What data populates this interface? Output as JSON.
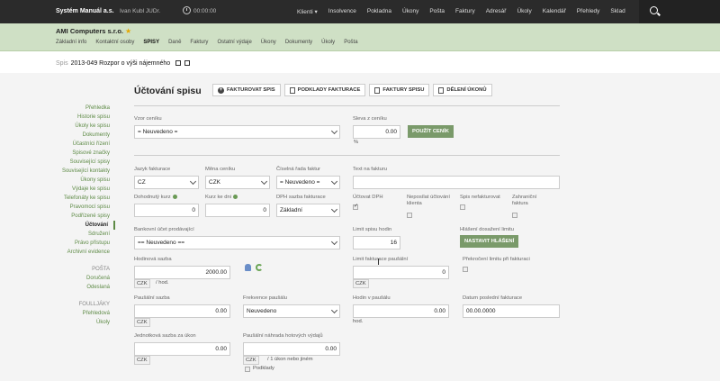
{
  "topbar": {
    "brand": "Systém Manuál a.s.",
    "user": "Ivan Kubl JUDr.",
    "timer": "00:00:00",
    "nav": [
      "Klienti ▾",
      "Insolvence",
      "Pokladna",
      "Úkony",
      "Pošta",
      "Faktury",
      "Adresář",
      "Úkoly",
      "Kalendář",
      "Přehledy",
      "Sklad"
    ]
  },
  "company": {
    "name": "AMI Computers s.r.o.",
    "tabs": [
      "Základní info",
      "Kontaktní osoby",
      "SPISY",
      "Daně",
      "Faktury",
      "Ostatní výdaje",
      "Úkony",
      "Dokumenty",
      "Úkoly",
      "Pošta"
    ],
    "active_tab": "SPISY"
  },
  "titlebar": {
    "prefix": "Spis",
    "title": "2013-049 Rozpor o výši nájemného"
  },
  "sidebar": {
    "items": [
      "Přehledka",
      "Historie spisu",
      "Úkoly ke spisu",
      "Dokumenty",
      "Účastníci řízení",
      "Spisové značky",
      "Související spisy",
      "Související kontakty",
      "Úkony spisu",
      "Výdaje ke spisu",
      "Telefonáty ke spisu",
      "Pravomocí spisu",
      "Podřízené spisy",
      "Účtování",
      "Sdružení",
      "Právo přístupu",
      "Archivní evidence"
    ],
    "active": "Účtování",
    "section_posta": "POŠTA",
    "posta_items": [
      "Doručená",
      "Odeslaná"
    ],
    "section_fakt": "FOULLJÁKY",
    "fakt_items": [
      "Přehledová",
      "Úkoly"
    ]
  },
  "main": {
    "title": "Účtování spisu",
    "buttons": [
      "FAKTUROVAT SPIS",
      "PODKLADY FAKTURACE",
      "FAKTURY SPISU",
      "DĚLENÍ ÚKONŮ"
    ],
    "vzor_ceniku_label": "Vzor ceníku",
    "vzor_ceniku_value": "= Neuvedeno =",
    "sleva_label": "Sleva z ceníku",
    "sleva_value": "0.00",
    "sleva_unit": "%",
    "use_cenik_btn": "POUŽÍT CENÍK",
    "jazyk_label": "Jazyk fakturace",
    "jazyk_value": "CZ",
    "mena_label": "Měna ceníku",
    "mena_value": "CZK",
    "cislo_rady_label": "Číselná řada faktur",
    "cislo_rady_value": "= Neuvedeno =",
    "text_label": "Text na fakturu",
    "text_value": "",
    "dohod_label": "Dohodnutý kurz",
    "dohod_value": "0",
    "kurz_label": "Kurz ke dni",
    "kurz_value": "0",
    "dph_label": "DPH sazba fakturace",
    "dph_value": "Základní",
    "uctovat_dph_label": "Účtovat DPH",
    "neposilat_label": "Neposílat účtování klienta",
    "spis_nefakt_label": "Spis nefakturovat",
    "zahranicni_label": "Zahraniční faktura",
    "bank_label": "Bankovní účet prodávající",
    "bank_value": "== Neuvedeno ==",
    "limit_label": "Limit spisu hodin",
    "limit_value": "16",
    "hlaseni_label": "Hlášení dosažení limitu",
    "hlaseni_btn": "NASTAVIT HLÁŠENÍ",
    "hodinova_label": "Hodinová sazba",
    "hodinova_value": "2000.00",
    "hodinova_cur": "CZK",
    "hodinova_unit": "/ hod.",
    "limit_fakt_label": "Limit fakturace paušální",
    "limit_fakt_value": "0",
    "limit_fakt_cur": "CZK",
    "prekroceni_label": "Překročení limitu při fakturaci",
    "pausalni_label": "Paušální sazba",
    "pausalni_value": "0.00",
    "pausalni_cur": "CZK",
    "frekvence_label": "Frekvence paušálu",
    "frekvence_value": "Neuvedeno",
    "hodin_label": "Hodin v paušálu",
    "hodin_value": "0.00",
    "hodin_unit": "hod.",
    "datum_label": "Datum poslední fakturace",
    "datum_value": "00.00.0000",
    "jednotka_label": "Jednotková sazba za úkon",
    "jednotka_value": "0.00",
    "jednotka_cur": "CZK",
    "nahrada_label": "Paušální náhrada hotových výdajů",
    "nahrada_value": "0.00",
    "nahrada_cur": "CZK",
    "nahrada_unit": "/ 1 úkon nebo jiném",
    "nahrada_check": "Podklady"
  }
}
